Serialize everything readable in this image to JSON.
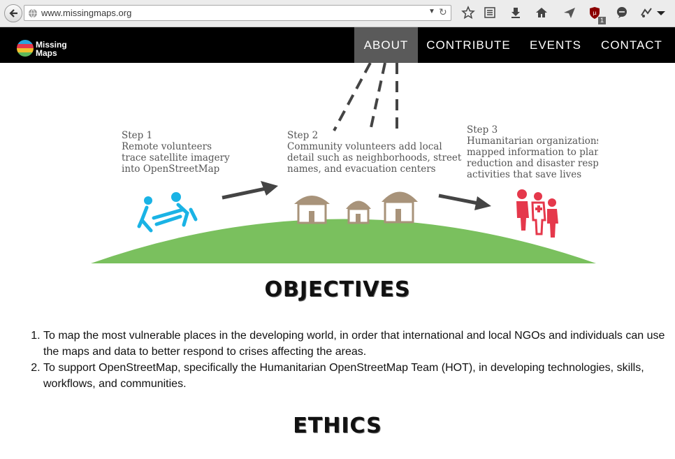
{
  "browser": {
    "url": "www.missingmaps.org",
    "ublock_count": "1"
  },
  "site": {
    "logo_line1": "Missing",
    "logo_line2": "Maps",
    "nav": [
      {
        "label": "ABOUT",
        "active": true
      },
      {
        "label": "CONTRIBUTE",
        "active": false
      },
      {
        "label": "EVENTS",
        "active": false
      },
      {
        "label": "CONTACT",
        "active": false
      }
    ]
  },
  "steps": [
    {
      "text": "Step 1\nRemote volunteers\ntrace satellite imagery\ninto OpenStreetMap"
    },
    {
      "text": "Step 2\nCommunity volunteers add local\ndetail such as neighborhoods, street\nnames, and evacuation centers"
    },
    {
      "text": "Step 3\nHumanitarian organizations\nmapped information to plan r\nreduction and disaster respo\nactivities that save lives"
    }
  ],
  "colors": {
    "hill": "#7ac05e",
    "volunteers": "#1ab3e5",
    "humanitarians": "#e5384b",
    "huts": "#a8937a",
    "arrow": "#444444"
  },
  "objectives": {
    "heading": "OBJECTIVES",
    "items": [
      "To map the most vulnerable places in the developing world, in order that international and local NGOs and individuals can use the maps and data to better respond to crises affecting the areas.",
      "To support OpenStreetMap, specifically the Humanitarian OpenStreetMap Team (HOT), in developing technologies, skills, workflows, and communities."
    ]
  },
  "ethics": {
    "heading": "ETHICS"
  }
}
